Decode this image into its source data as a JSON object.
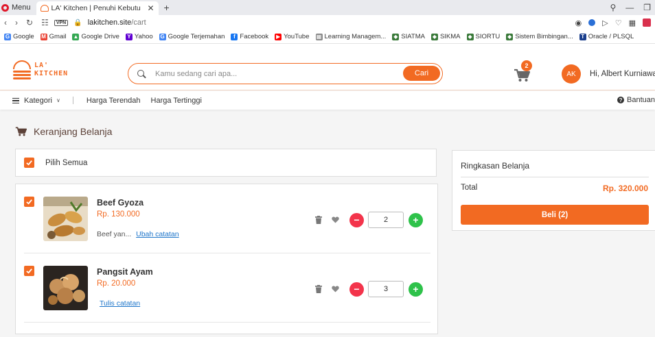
{
  "browser": {
    "menu_label": "Menu",
    "tab_title": "LA' Kitchen | Penuhi Kebutu",
    "tab_close": "✕",
    "new_tab": "+",
    "url_host": "lakitchen.site",
    "url_path": "/cart",
    "vpn_label": "VPN",
    "bookmarks": [
      {
        "label": "Google",
        "icon": "google-icon",
        "color": "#4285f4",
        "glyph": "G"
      },
      {
        "label": "Gmail",
        "icon": "gmail-icon",
        "color": "#ea4335",
        "glyph": "M"
      },
      {
        "label": "Google Drive",
        "icon": "drive-icon",
        "color": "#34a853",
        "glyph": "▲"
      },
      {
        "label": "Yahoo",
        "icon": "yahoo-icon",
        "color": "#6001d2",
        "glyph": "Y"
      },
      {
        "label": "Google Terjemahan",
        "icon": "translate-icon",
        "color": "#4285f4",
        "glyph": "G"
      },
      {
        "label": "Facebook",
        "icon": "facebook-icon",
        "color": "#1877f2",
        "glyph": "f"
      },
      {
        "label": "YouTube",
        "icon": "youtube-icon",
        "color": "#ff0000",
        "glyph": "▶"
      },
      {
        "label": "Learning Managem...",
        "icon": "learning-icon",
        "color": "#888888",
        "glyph": "▦"
      },
      {
        "label": "SIATMA",
        "icon": "siatma-icon",
        "color": "#3a7a3a",
        "glyph": "◆"
      },
      {
        "label": "SIKMA",
        "icon": "sikma-icon",
        "color": "#3a7a3a",
        "glyph": "◆"
      },
      {
        "label": "SIORTU",
        "icon": "siortu-icon",
        "color": "#3a7a3a",
        "glyph": "◆"
      },
      {
        "label": "Sistem Bimbingan...",
        "icon": "bimbingan-icon",
        "color": "#3a7a3a",
        "glyph": "◆"
      },
      {
        "label": "Oracle / PLSQL",
        "icon": "oracle-icon",
        "color": "#1a3e8c",
        "glyph": "T"
      }
    ]
  },
  "header": {
    "logo_line1": "LA'",
    "logo_line2": "KITCHEN",
    "search_placeholder": "Kamu sedang cari apa...",
    "search_button": "Cari",
    "cart_count": "2",
    "avatar_initials": "AK",
    "greeting": "Hi, Albert Kurniawan"
  },
  "nav": {
    "category_label": "Kategori",
    "links": [
      "Harga Terendah",
      "Harga Tertinggi"
    ],
    "help_label": "Bantuan"
  },
  "cart": {
    "title": "Keranjang Belanja",
    "select_all_label": "Pilih Semua",
    "items": [
      {
        "name": "Beef Gyoza",
        "price": "Rp. 130.000",
        "note_text": "Beef yan...",
        "note_link": "Ubah catatan",
        "quantity": "2",
        "checked": true
      },
      {
        "name": "Pangsit Ayam",
        "price": "Rp. 20.000",
        "note_text": "",
        "note_link": "Tulis catatan",
        "quantity": "3",
        "checked": true
      }
    ]
  },
  "summary": {
    "title": "Ringkasan Belanja",
    "total_label": "Total",
    "total_value": "Rp. 320.000",
    "buy_label": "Beli (2)"
  },
  "colors": {
    "accent": "#f26a22",
    "minus": "#f3344b",
    "plus": "#2ec24a",
    "title_brown": "#5b4037"
  }
}
